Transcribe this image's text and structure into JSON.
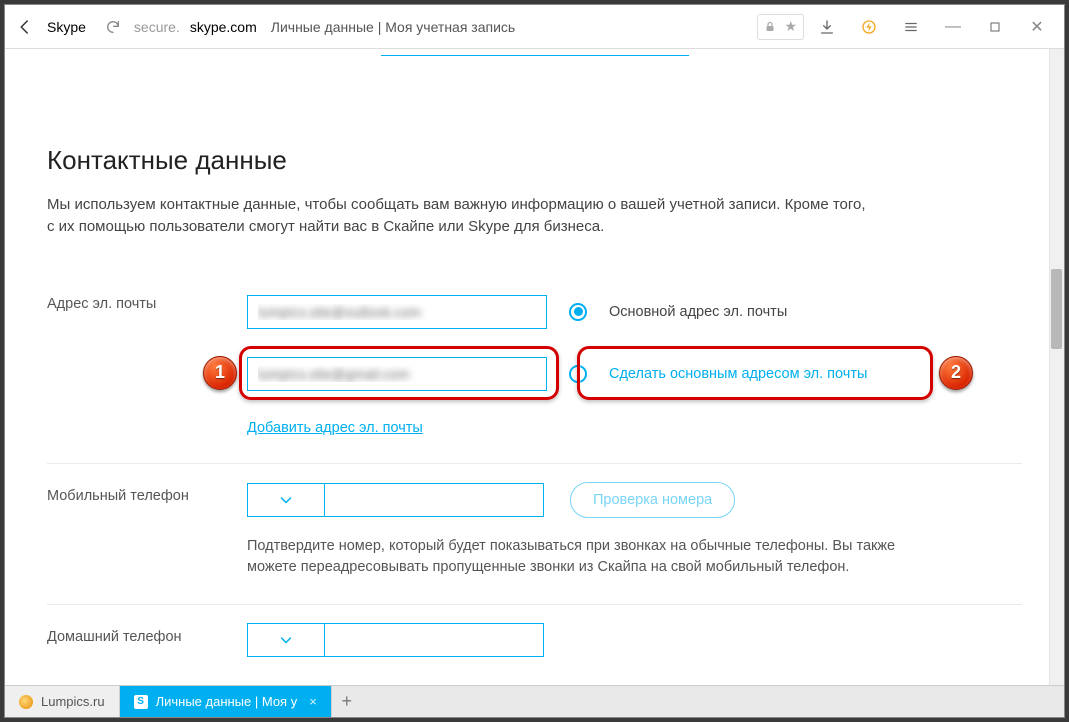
{
  "browser": {
    "site_label": "Skype",
    "url_host": "secure.",
    "url_bold": "skype.com",
    "page_title": "Личные данные | Моя учетная запись"
  },
  "window_controls": {
    "min": "—",
    "max": "☐",
    "close": "✕"
  },
  "section": {
    "title": "Контактные данные",
    "description": "Мы используем контактные данные, чтобы сообщать вам важную информацию о вашей учетной записи. Кроме того, с их помощью пользователи смогут найти вас в Скайпе или Skype для бизнеса."
  },
  "fields": {
    "email_label": "Адрес эл. почты",
    "email1_value": "lumpics.site@outlook.com",
    "email1_radio": "Основной адрес эл. почты",
    "email2_value": "lumpics.site@gmail.com",
    "email2_radio": "Сделать основным адресом эл. почты",
    "add_email": "Добавить адрес эл. почты",
    "mobile_label": "Мобильный телефон",
    "verify_button": "Проверка номера",
    "mobile_note": "Подтвердите номер, который будет показываться при звонках на обычные телефоны. Вы также можете переадресовывать пропущенные звонки из Скайпа на свой мобильный телефон.",
    "home_label": "Домашний телефон"
  },
  "annotations": {
    "b1": "1",
    "b2": "2"
  },
  "tabs": {
    "t1": "Lumpics.ru",
    "t2": "Личные данные | Моя у",
    "t2_icon": "S"
  }
}
